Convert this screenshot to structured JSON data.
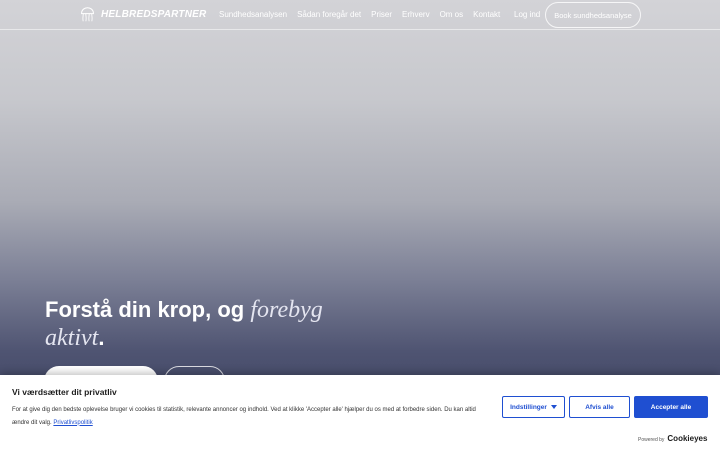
{
  "header": {
    "logo_text": "HELBREDSPARTNER",
    "logo_icon": "jellyfish-icon",
    "nav": [
      "Sundhedsanalysen",
      "Sådan foregår det",
      "Priser",
      "Erhverv",
      "Om os",
      "Kontakt"
    ],
    "login_label": "Log ind",
    "cta_label": "Book sundhedsanalyse"
  },
  "hero": {
    "headline_main": "Forstå din krop, og ",
    "headline_em1": "forebyg",
    "headline_em2": "aktivt",
    "headline_end": "."
  },
  "cookie_banner": {
    "title": "Vi værdsætter dit privatliv",
    "text": "For at give dig den bedste oplevelse bruger vi cookies til statistik, relevante annoncer og indhold. Ved at klikke 'Accepter alle' hjælper du os med at forbedre siden. Du kan altid ændre dit valg.",
    "link_label": "Privatlivspolitik",
    "settings_label": "Indstillinger",
    "reject_label": "Afvis alle",
    "accept_label": "Accepter alle",
    "powered_label": "Powered by",
    "powered_brand": "Cookieyes",
    "accent_color": "#1f4fd1"
  }
}
